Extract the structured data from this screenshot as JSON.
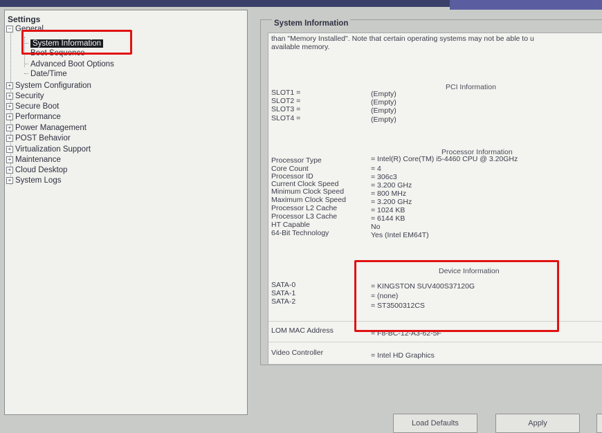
{
  "left_panel": {
    "title": "Settings",
    "tree": {
      "general": "General",
      "general_children": [
        "System Information",
        "Boot Sequence",
        "Advanced Boot Options",
        "Date/Time"
      ],
      "top_items": [
        "System Configuration",
        "Security",
        "Secure Boot",
        "Performance",
        "Power Management",
        "POST Behavior",
        "Virtualization Support",
        "Maintenance",
        "Cloud Desktop",
        "System Logs"
      ],
      "expand_glyph": "+",
      "collapse_glyph": "−"
    }
  },
  "system_information": {
    "title": "System Information",
    "memory_note_1": "than \"Memory Installed\". Note that certain operating systems may not be able to u",
    "memory_note_2": "available memory.",
    "pci_header": "PCI Information",
    "slots": [
      {
        "label": "SLOT1 =",
        "value": "(Empty)"
      },
      {
        "label": "SLOT2 =",
        "value": "(Empty)"
      },
      {
        "label": "SLOT3 =",
        "value": "(Empty)"
      },
      {
        "label": "SLOT4 =",
        "value": "(Empty)"
      }
    ],
    "processor_header": "Processor Information",
    "processor": [
      {
        "label": "Processor Type",
        "value": "= Intel(R) Core(TM) i5-4460 CPU @ 3.20GHz"
      },
      {
        "label": "Core Count",
        "value": "= 4"
      },
      {
        "label": "Processor ID",
        "value": "= 306c3"
      },
      {
        "label": "Current Clock Speed",
        "value": "= 3.200 GHz"
      },
      {
        "label": "Minimum Clock Speed",
        "value": "= 800 MHz"
      },
      {
        "label": "Maximum Clock Speed",
        "value": "= 3.200 GHz"
      },
      {
        "label": "Processor L2 Cache",
        "value": "= 1024 KB"
      },
      {
        "label": "Processor L3 Cache",
        "value": "= 6144 KB"
      },
      {
        "label": "HT Capable",
        "value": "No"
      },
      {
        "label": "64-Bit Technology",
        "value": "Yes (Intel EM64T)"
      }
    ],
    "device_header": "Device Information",
    "devices": [
      {
        "label": "SATA-0",
        "value": "= KINGSTON SUV400S37120G"
      },
      {
        "label": "SATA-1",
        "value": "= (none)"
      },
      {
        "label": "SATA-2",
        "value": "= ST3500312CS"
      }
    ],
    "lom_label": "LOM MAC Address",
    "lom_value": "= F8-BC-12-A3-62-5F",
    "video_label": "Video Controller",
    "video_value": "= Intel HD Graphics"
  },
  "buttons": {
    "load_defaults": "Load Defaults",
    "apply": "Apply"
  },
  "colors": {
    "highlight_box": "#e01212",
    "selected_bg": "#1b1d22"
  }
}
